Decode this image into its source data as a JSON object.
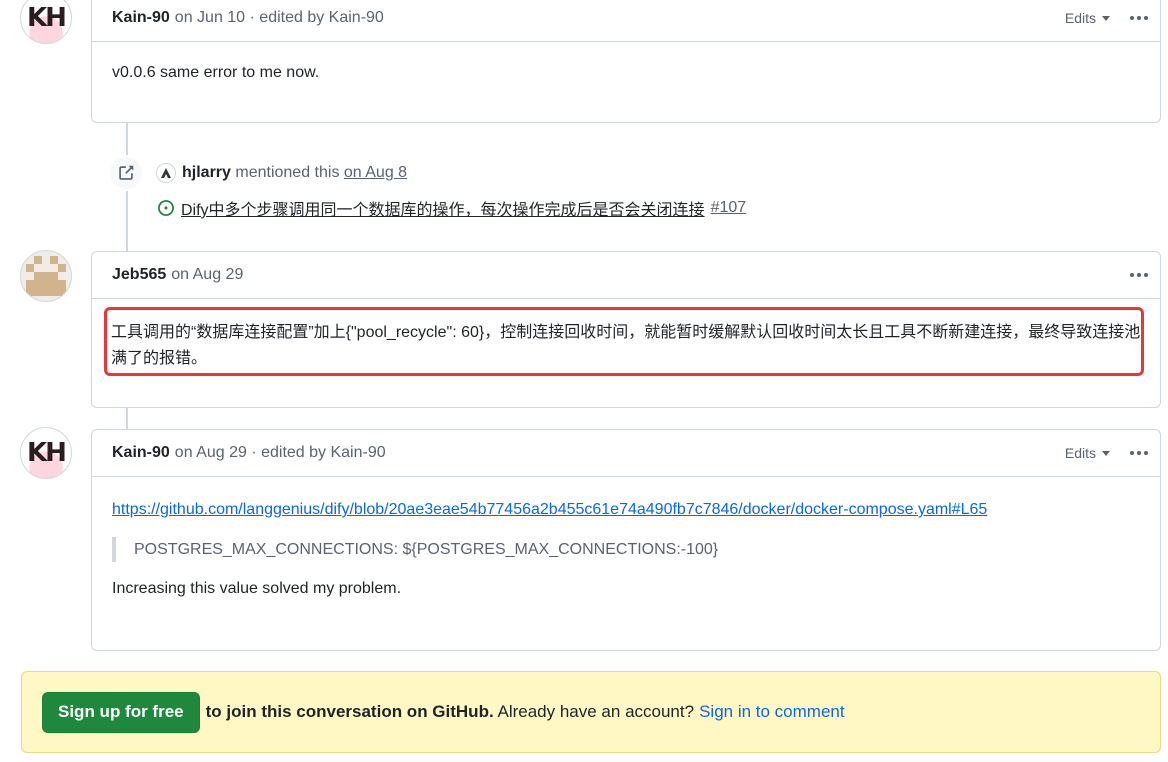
{
  "comments": [
    {
      "avatar_initials": "KH",
      "author": "Kain-90",
      "meta": "on Jun 10 · edited by Kain-90",
      "edits_label": "Edits",
      "body": "v0.0.6 same error to me now."
    },
    {
      "author": "Jeb565",
      "meta": "on Aug 29",
      "body": "工具调用的“数据库连接配置”加上{\"pool_recycle\": 60}，控制连接回收时间，就能暂时缓解默认回收时间太长且工具不断新建连接，最终导致连接池满了的报错。"
    },
    {
      "avatar_initials": "KH",
      "author": "Kain-90",
      "meta": "on Aug 29 · edited by Kain-90",
      "edits_label": "Edits",
      "link": "https://github.com/langgenius/dify/blob/20ae3eae54b77456a2b455c61e74a490fb7c7846/docker/docker-compose.yaml#L65",
      "quote": "POSTGRES_MAX_CONNECTIONS: ${POSTGRES_MAX_CONNECTIONS:-100}",
      "body": "Increasing this value solved my problem."
    }
  ],
  "mention": {
    "user": "hjlarry",
    "action": "mentioned this",
    "date": "on Aug 8",
    "issue_title": "Dify中多个步骤调用同一个数据库的操作，每次操作完成后是否会关闭连接",
    "issue_number": "#107"
  },
  "signup": {
    "button": "Sign up for free",
    "text_bold": "to join this conversation on GitHub.",
    "text": "Already have an account?",
    "signin": "Sign in to comment"
  },
  "colors": {
    "highlight": "#e5383b",
    "link": "#0969da",
    "signup_button": "#1f883d",
    "banner_bg": "#fff8c5",
    "open_issue": "#1a7f37"
  }
}
